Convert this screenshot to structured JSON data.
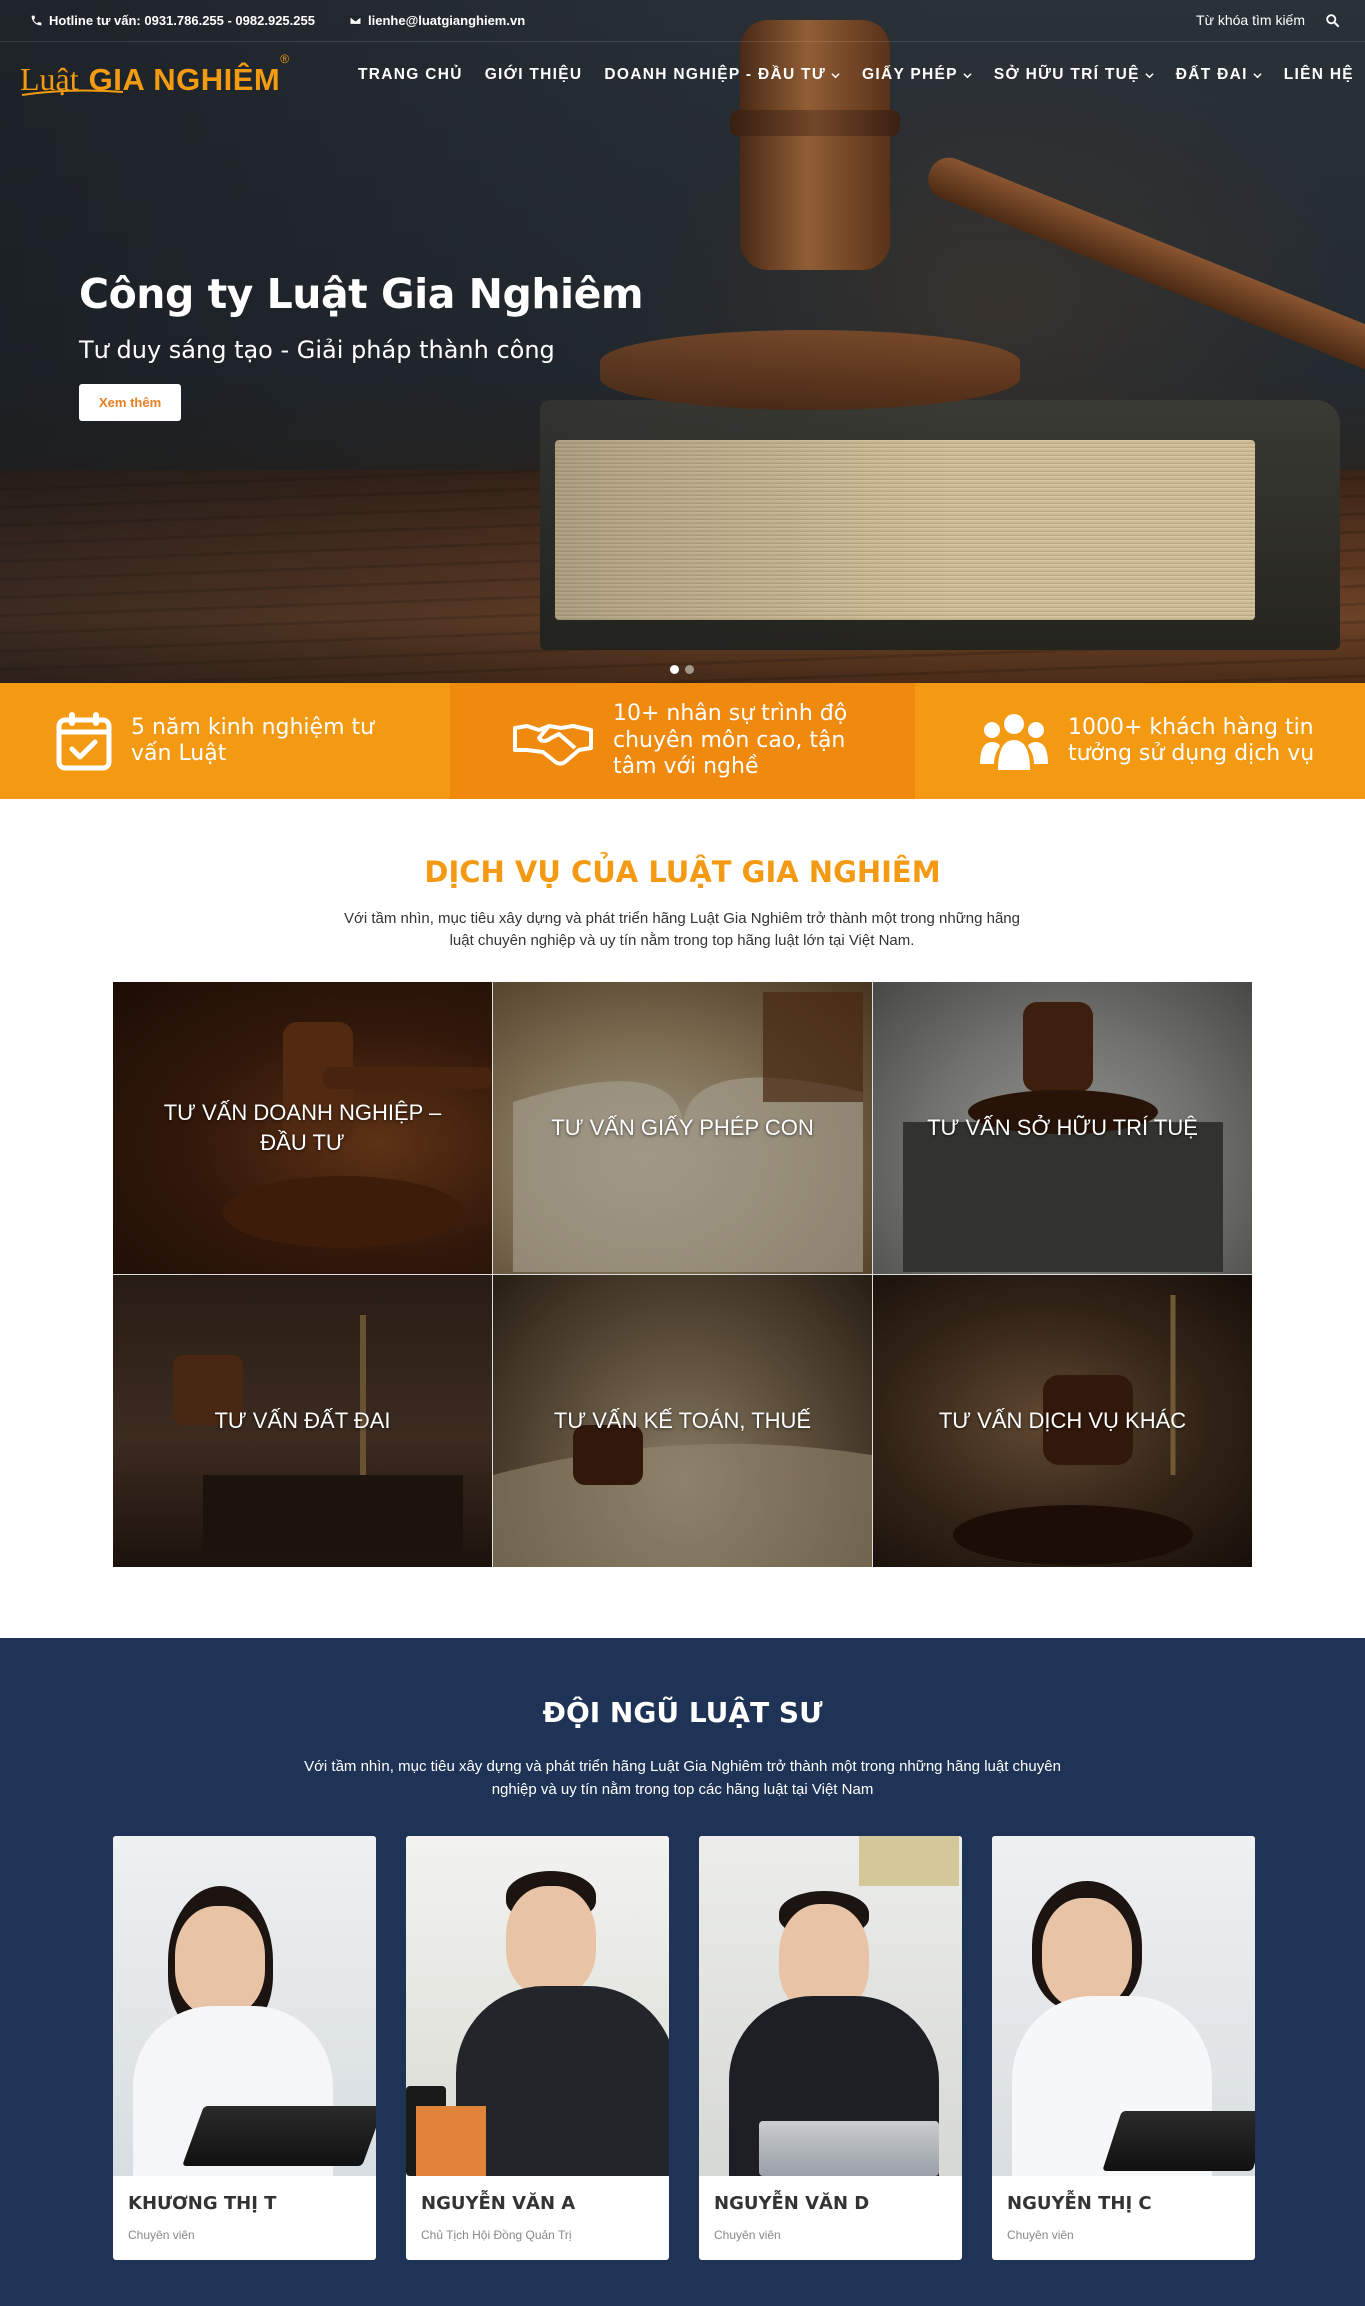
{
  "topbar": {
    "hotline": "Hotline tư vấn: 0931.786.255 - 0982.925.255",
    "email": "lienhe@luatgianghiem.vn",
    "search_placeholder": "Từ khóa tìm kiếm"
  },
  "logo": {
    "part1": "Luật",
    "part2": "GIA NGHIÊM",
    "mark": "®"
  },
  "nav": [
    {
      "label": "TRANG CHỦ",
      "dropdown": false
    },
    {
      "label": "GIỚI THIỆU",
      "dropdown": false
    },
    {
      "label": "DOANH NGHIỆP - ĐẦU TƯ",
      "dropdown": true
    },
    {
      "label": "GIẤY PHÉP",
      "dropdown": true
    },
    {
      "label": "SỞ HỮU TRÍ TUỆ",
      "dropdown": true
    },
    {
      "label": "ĐẤT ĐAI",
      "dropdown": true
    },
    {
      "label": "LIÊN HỆ",
      "dropdown": false
    }
  ],
  "hero": {
    "title": "Công ty Luật Gia Nghiêm",
    "subtitle": "Tư duy sáng tạo - Giải pháp thành công",
    "button": "Xem thêm",
    "slide_count": 2,
    "active_slide": 1
  },
  "features": [
    {
      "icon": "calendar-check-icon",
      "text": "5 năm kinh nghiệm tư vấn Luật"
    },
    {
      "icon": "handshake-icon",
      "text": "10+ nhân sự trình độ chuyên môn cao, tận tâm với nghề"
    },
    {
      "icon": "users-icon",
      "text": "1000+ khách hàng tin tưởng sử dụng dịch vụ"
    }
  ],
  "services": {
    "title": "DỊCH VỤ CỦA LUẬT GIA NGHIÊM",
    "description": "Với tầm nhìn, mục tiêu xây dựng và phát triển hãng Luật Gia Nghiêm trở thành một trong những hãng luật chuyên nghiệp và uy tín nằm trong top hãng luật lớn tại Việt Nam.",
    "items": [
      {
        "label": "TƯ VẤN DOANH NGHIỆP – ĐẦU TƯ"
      },
      {
        "label": "TƯ VẤN GIẤY PHÉP CON"
      },
      {
        "label": "TƯ VẤN SỞ HỮU TRÍ TUỆ"
      },
      {
        "label": "TƯ VẤN ĐẤT ĐAI"
      },
      {
        "label": "TƯ VẤN KẾ TOÁN, THUẾ"
      },
      {
        "label": "TƯ VẤN DỊCH VỤ KHÁC"
      }
    ]
  },
  "team": {
    "title": "ĐỘI NGŨ LUẬT SƯ",
    "description": "Với tầm nhìn, mục tiêu xây dựng và phát triển hãng Luật Gia Nghiêm trở thành một trong những hãng luật chuyên nghiệp và uy tín nằm trong top các hãng luật tại Việt Nam",
    "members": [
      {
        "name": "KHƯƠNG THỊ T",
        "role": "Chuyên viên"
      },
      {
        "name": "NGUYỄN VĂN A",
        "role": "Chủ Tịch Hội Đồng Quản Trị"
      },
      {
        "name": "NGUYỄN VĂN D",
        "role": "Chuyên viên"
      },
      {
        "name": "NGUYỄN THỊ C",
        "role": "Chuyên viên"
      }
    ]
  },
  "colors": {
    "accent": "#f39a12",
    "navy": "#1e3356",
    "text": "#333333"
  }
}
